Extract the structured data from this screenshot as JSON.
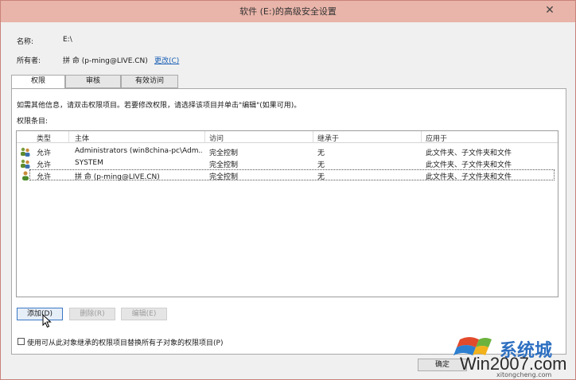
{
  "window": {
    "title": "软件 (E:)的高级安全设置",
    "close_glyph": "✕"
  },
  "info": {
    "name_label": "名称:",
    "name_value": "E:\\",
    "owner_label": "所有者:",
    "owner_value": "拼 命 (p-ming@LIVE.CN)",
    "change_link": "更改(C)"
  },
  "tabs": [
    {
      "label": "权限",
      "active": true
    },
    {
      "label": "审核",
      "active": false
    },
    {
      "label": "有效访问",
      "active": false
    }
  ],
  "instructions": "如需其他信息，请双击权限项目。若要修改权限，请选择该项目并单击\"编辑\"(如果可用)。",
  "entries_label": "权限条目:",
  "table": {
    "columns": [
      "类型",
      "主体",
      "访问",
      "继承于",
      "应用于"
    ],
    "rows": [
      {
        "type": "允许",
        "principal": "Administrators (win8china-pc\\Adm...",
        "access": "完全控制",
        "inherited": "无",
        "applies": "此文件夹、子文件夹和文件",
        "icon": "user-group-icon"
      },
      {
        "type": "允许",
        "principal": "SYSTEM",
        "access": "完全控制",
        "inherited": "无",
        "applies": "此文件夹、子文件夹和文件",
        "icon": "user-group-icon"
      },
      {
        "type": "允许",
        "principal": "拼 命 (p-ming@LIVE.CN)",
        "access": "完全控制",
        "inherited": "无",
        "applies": "此文件夹、子文件夹和文件",
        "icon": "user-icon"
      }
    ]
  },
  "buttons": {
    "add": "添加(D)",
    "remove": "删除(R)",
    "edit": "编辑(E)",
    "ok": "确定"
  },
  "replace_checkbox": "使用可从此对象继承的权限项目替换所有子对象的权限项目(P)",
  "watermark": {
    "brand": "Win2007.com",
    "brand_cn": "系统城",
    "domain": "xitongcheng.com"
  },
  "colors": {
    "accent": "#1a5fb4",
    "titlebar": "#e9b4a9"
  }
}
